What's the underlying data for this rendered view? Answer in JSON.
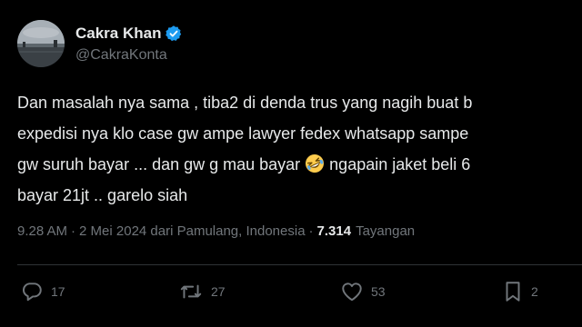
{
  "author": {
    "display_name": "Cakra Khan",
    "handle": "@CakraKonta",
    "verified": true,
    "verified_color": "#1d9bf0"
  },
  "tweet": {
    "lines": [
      "Dan masalah nya sama , tiba2 di denda trus yang nagih buat b",
      "expedisi nya klo case gw ampe lawyer fedex whatsapp sampe",
      "gw suruh bayar ... dan gw g mau bayar ",
      " ngapain jaket beli 6",
      "bayar 21jt .. garelo siah"
    ],
    "emoji": "rolling-on-the-floor-laughing"
  },
  "meta": {
    "time": "9.28 AM",
    "separator": "·",
    "date_location": "2 Mei 2024 dari Pamulang, Indonesia",
    "views_count": "7.314",
    "views_label": "Tayangan"
  },
  "actions": {
    "replies": "17",
    "retweets": "27",
    "likes": "53",
    "bookmarks": "2"
  },
  "colors": {
    "background": "#000000",
    "text": "#e7e9ea",
    "secondary": "#71767b",
    "divider": "#2f3336"
  }
}
